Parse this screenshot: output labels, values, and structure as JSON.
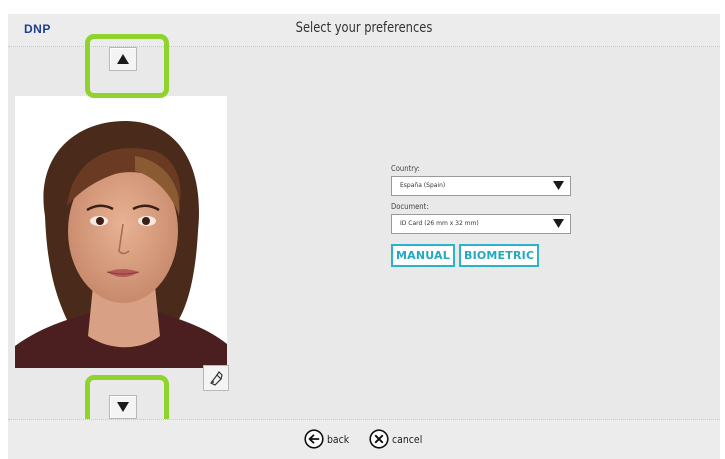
{
  "app": {
    "logo": "DNP",
    "title": "Select your preferences"
  },
  "nav": {
    "up_icon": "triangle-up-icon",
    "down_icon": "triangle-down-icon"
  },
  "photo": {
    "crop_icon": "crop-tool-icon"
  },
  "form": {
    "country_label": "Country:",
    "country_value": "España (Spain)",
    "document_label": "Document:",
    "document_value": "ID Card (26 mm x 32 mm)"
  },
  "modes": {
    "manual_label": "MANUAL",
    "biometric_label": "BIOMETRIC"
  },
  "footer": {
    "back_label": "back",
    "cancel_label": "cancel",
    "back_icon": "arrow-left-circle-icon",
    "cancel_icon": "x-circle-icon"
  },
  "colors": {
    "highlight": "#8ed42c",
    "accent": "#2bb3c8",
    "logo": "#1f3f95"
  }
}
